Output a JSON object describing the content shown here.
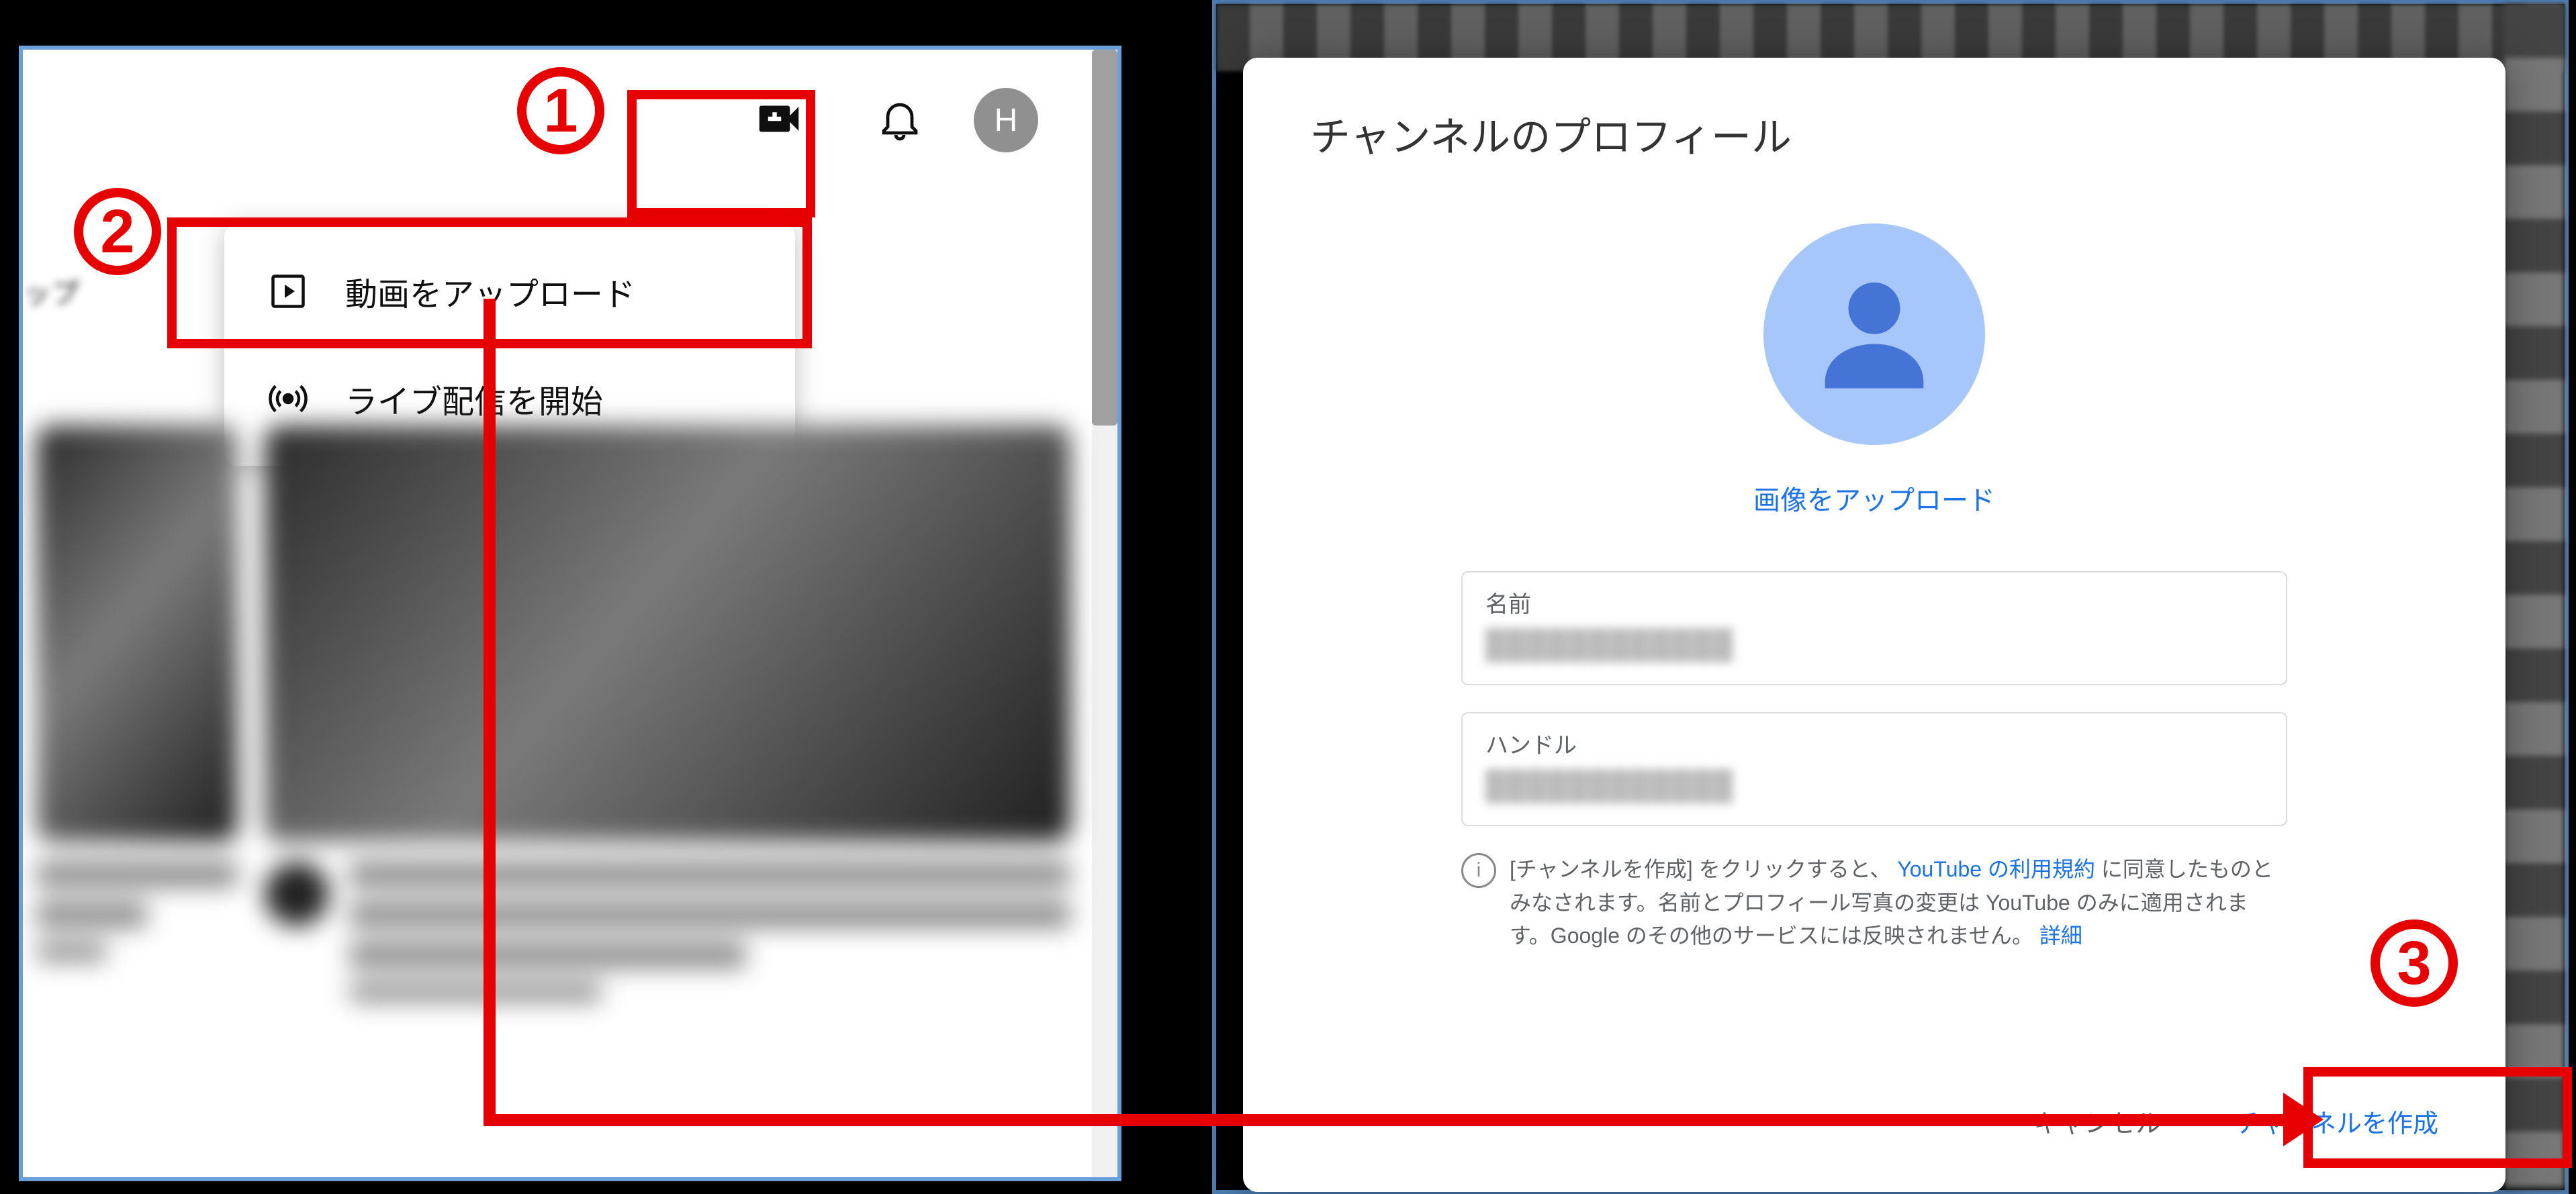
{
  "steps": {
    "s1": "1",
    "s2": "2",
    "s3": "3"
  },
  "topbar": {
    "avatar_initial": "H"
  },
  "create_menu": {
    "upload_label": "動画をアップロード",
    "live_label": "ライブ配信を開始"
  },
  "left_edge_text": "ップ",
  "modal": {
    "title": "チャンネルのプロフィール",
    "upload_image_label": "画像をアップロード",
    "fields": {
      "name_label": "名前",
      "handle_label": "ハンドル"
    },
    "disclosure": {
      "text1": "[チャンネルを作成] をクリックすると、",
      "tos_link": "YouTube の利用規約",
      "text2": "に同意したものとみなされます。名前とプロフィール写真の変更は YouTube のみに適用されます。Google のその他のサービスには反映されません。",
      "details_link": "詳細"
    },
    "actions": {
      "cancel": "キャンセル",
      "create": "チャンネルを作成"
    }
  }
}
